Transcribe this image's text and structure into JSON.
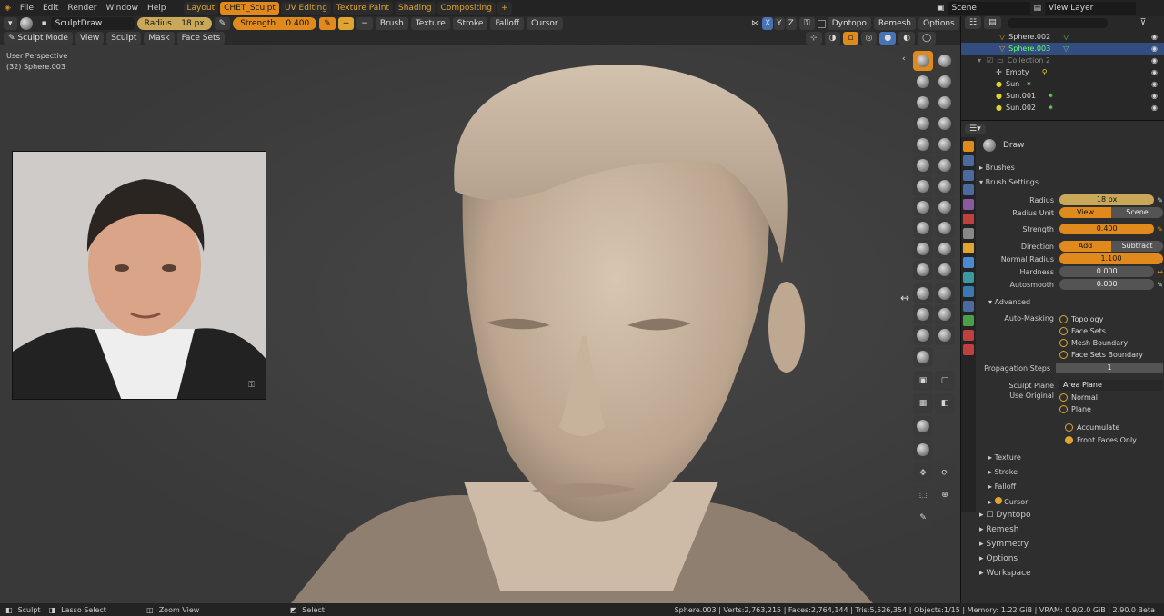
{
  "menus": [
    "File",
    "Edit",
    "Render",
    "Window",
    "Help"
  ],
  "workspaces": [
    "Layout",
    "CHET_Sculpt",
    "UV Editing",
    "Texture Paint",
    "Shading",
    "Compositing",
    "+"
  ],
  "scene": "Scene",
  "view_layer": "View Layer",
  "tool_header": {
    "brush": "SculptDraw",
    "radius_label": "Radius",
    "radius_value": "18 px",
    "strength_label": "Strength",
    "strength_value": "0.400",
    "plus": "+",
    "minus": "−",
    "menus": [
      "Brush",
      "Texture",
      "Stroke",
      "Falloff",
      "Cursor"
    ],
    "axes": [
      "X",
      "Y",
      "Z"
    ],
    "dyntopo": "Dyntopo",
    "remesh": "Remesh",
    "options": "Options"
  },
  "mode_header": {
    "mode": "Sculpt Mode",
    "items": [
      "View",
      "Sculpt",
      "Mask",
      "Face Sets"
    ]
  },
  "viewport": {
    "perspective": "User Perspective",
    "object": "(32) Sphere.003"
  },
  "outliner": [
    {
      "name": "Sphere.002"
    },
    {
      "name": "Sphere.003"
    },
    {
      "name": "Collection 2"
    },
    {
      "name": "Empty"
    },
    {
      "name": "Sun"
    },
    {
      "name": "Sun.001"
    },
    {
      "name": "Sun.002"
    }
  ],
  "props": {
    "brush_name": "Draw",
    "brushes": "Brushes",
    "brush_settings": "Brush Settings",
    "radius": {
      "label": "Radius",
      "value": "18 px"
    },
    "radius_unit": {
      "label": "Radius Unit",
      "a": "View",
      "b": "Scene"
    },
    "strength": {
      "label": "Strength",
      "value": "0.400"
    },
    "direction": {
      "label": "Direction",
      "a": "Add",
      "b": "Subtract"
    },
    "normal_radius": {
      "label": "Normal Radius",
      "value": "1.100"
    },
    "hardness": {
      "label": "Hardness",
      "value": "0.000"
    },
    "autosmooth": {
      "label": "Autosmooth",
      "value": "0.000"
    },
    "advanced": "Advanced",
    "auto_masking": {
      "label": "Auto-Masking",
      "options": [
        "Topology",
        "Face Sets",
        "Mesh Boundary",
        "Face Sets Boundary"
      ]
    },
    "propagation": {
      "label": "Propagation Steps",
      "value": "1"
    },
    "sculpt_plane": {
      "label": "Sculpt Plane",
      "value": "Area Plane"
    },
    "use_original": {
      "label": "Use Original",
      "options": [
        "Normal",
        "Plane"
      ]
    },
    "accumulate": "Accumulate",
    "front_faces": "Front Faces Only",
    "subpanels": [
      "Texture",
      "Stroke",
      "Falloff",
      "Cursor"
    ],
    "panels": [
      "Dyntopo",
      "Remesh",
      "Symmetry",
      "Options",
      "Workspace"
    ]
  },
  "status": {
    "sculpt": "Sculpt",
    "lasso": "Lasso Select",
    "zoom": "Zoom View",
    "select": "Select",
    "stats": "Sphere.003 | Verts:2,763,215 | Faces:2,764,144 | Tris:5,526,354 | Objects:1/15 | Memory: 1.22 GiB | VRAM: 0.9/2.0 GiB | 2.90.0 Beta"
  },
  "colors": {
    "accent": "#e08a1e",
    "panel": "#2e2e2e",
    "viewport": "#3f3f3f"
  }
}
